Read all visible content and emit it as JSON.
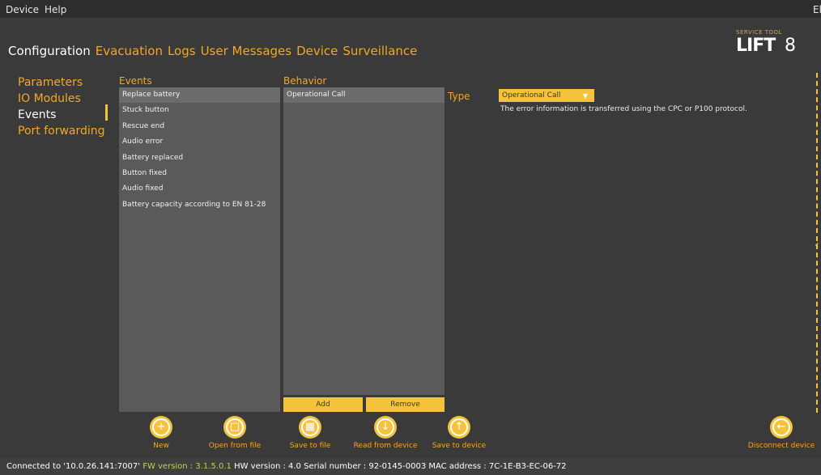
{
  "menu": {
    "device": "Device",
    "help": "Help",
    "right_fragment": "El"
  },
  "tabs": [
    {
      "label": "Configuration",
      "active": true
    },
    {
      "label": "Evacuation"
    },
    {
      "label": "Logs"
    },
    {
      "label": "User Messages"
    },
    {
      "label": "Device"
    },
    {
      "label": "Surveillance"
    }
  ],
  "logo": {
    "small": "SERVICE TOOL",
    "big": "LIFT",
    "num": "8"
  },
  "sidenav": [
    "Parameters",
    "IO Modules",
    "Events",
    "Port forwarding"
  ],
  "events": {
    "header": "Events",
    "items": [
      "Replace battery",
      "Stuck button",
      "Rescue end",
      "Audio error",
      "Battery replaced",
      "Button fixed",
      "Audio fixed",
      "Battery capacity according to EN 81-28"
    ]
  },
  "behavior": {
    "header": "Behavior",
    "items": [
      "Operational Call"
    ],
    "add": "Add",
    "remove": "Remove"
  },
  "type": {
    "label": "Type",
    "value": "Operational Call",
    "description": "The error information is transferred using the CPC or P100 protocol."
  },
  "actions": {
    "new": "New",
    "open": "Open from file",
    "save_file": "Save to file",
    "read": "Read from device",
    "save_device": "Save to device",
    "disconnect": "Disconnect device"
  },
  "status": {
    "connected": "Connected to '10.0.26.141:7007'",
    "fw": "FW version : 3.1.5.0.1",
    "hw": "HW version : 4.0",
    "serial": "Serial number : 92-0145-0003",
    "mac": "MAC address : 7C-1E-B3-EC-06-72"
  },
  "colors": {
    "accent": "#f5c23b",
    "orange_text": "#f5a623",
    "panel": "#5a5a5a",
    "bg": "#3a3a3a",
    "fw_green": "#b8d45a"
  }
}
